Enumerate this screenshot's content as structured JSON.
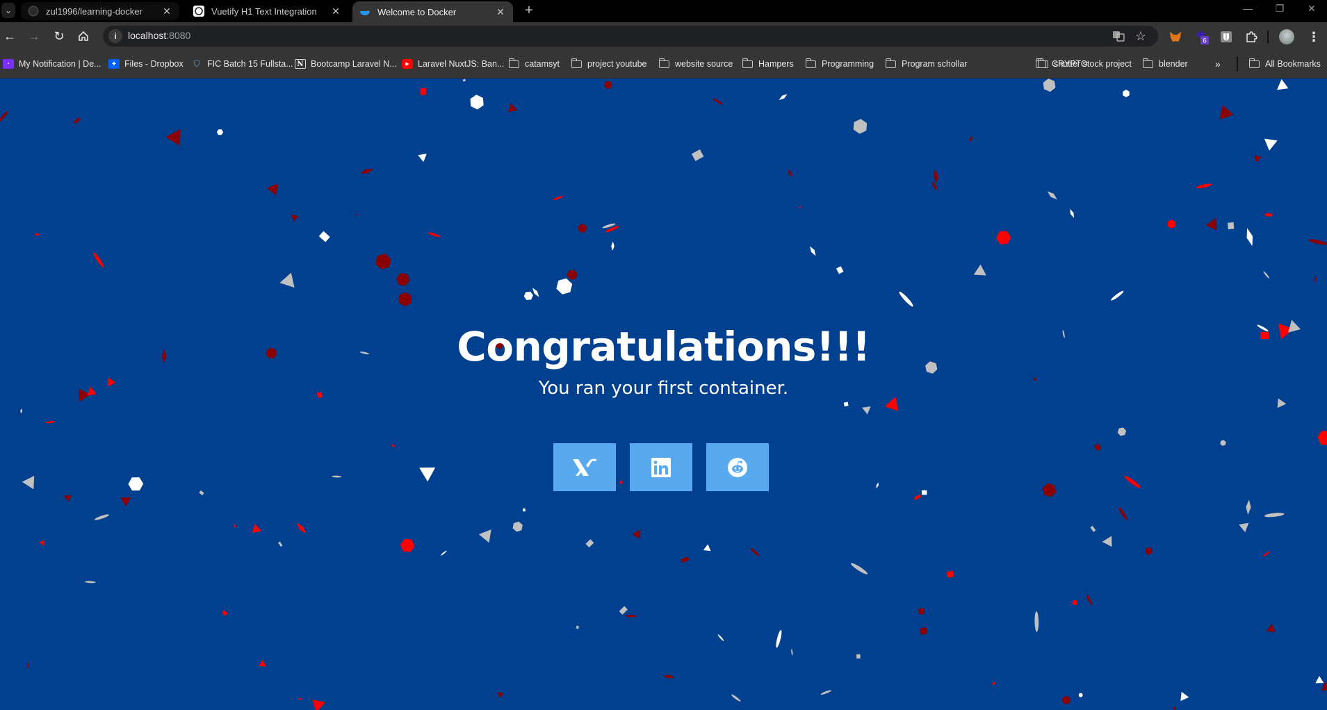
{
  "browser": {
    "tabs": [
      {
        "title": "zul1996/learning-docker",
        "icon": "github-icon",
        "active": false
      },
      {
        "title": "Vuetify H1 Text Integration",
        "icon": "chatgpt-icon",
        "active": false
      },
      {
        "title": "Welcome to Docker",
        "icon": "docker-whale-icon",
        "active": true
      }
    ],
    "new_tab_label": "+",
    "address": {
      "host": "localhost",
      "port": ":8080"
    },
    "extensions": [
      {
        "name": "metamask-icon"
      },
      {
        "name": "extension-badge-icon",
        "badge": "6"
      },
      {
        "name": "bitwarden-icon"
      },
      {
        "name": "puzzle-extensions-icon"
      }
    ],
    "bookmarks": [
      {
        "label": "My Notification | De...",
        "icon": "dealls-icon",
        "type": "site"
      },
      {
        "label": "Files - Dropbox",
        "icon": "dropbox-icon",
        "type": "site"
      },
      {
        "label": "FIC Batch 15 Fullsta...",
        "icon": "fic-icon",
        "type": "site"
      },
      {
        "label": "Bootcamp Laravel N...",
        "icon": "notion-icon",
        "type": "site"
      },
      {
        "label": "Laravel NuxtJS: Ban...",
        "icon": "youtube-icon",
        "type": "site"
      },
      {
        "label": "catamsyt",
        "type": "folder"
      },
      {
        "label": "project youtube",
        "type": "folder"
      },
      {
        "label": "website source",
        "type": "folder"
      },
      {
        "label": "Hampers",
        "type": "folder"
      },
      {
        "label": "Programming",
        "type": "folder"
      },
      {
        "label": "Program schollar",
        "type": "folder"
      },
      {
        "label": "CRYPTO",
        "type": "folder"
      },
      {
        "label": "shutter stock project",
        "type": "folder"
      },
      {
        "label": "blender",
        "type": "folder"
      }
    ],
    "all_bookmarks_label": "All Bookmarks",
    "overflow_label": "»"
  },
  "page": {
    "title": "Congratulations!!!",
    "subtitle": "You ran your first container.",
    "background_color": "#00408f",
    "button_color": "#58a9ed",
    "share_buttons": [
      {
        "name": "x-twitter",
        "icon": "x-logo-icon"
      },
      {
        "name": "linkedin",
        "icon": "linkedin-icon"
      },
      {
        "name": "reddit",
        "icon": "reddit-icon"
      }
    ],
    "confetti_colors": [
      "#ffffff",
      "#c0c0c0",
      "#ff0000",
      "#8b0000"
    ]
  }
}
